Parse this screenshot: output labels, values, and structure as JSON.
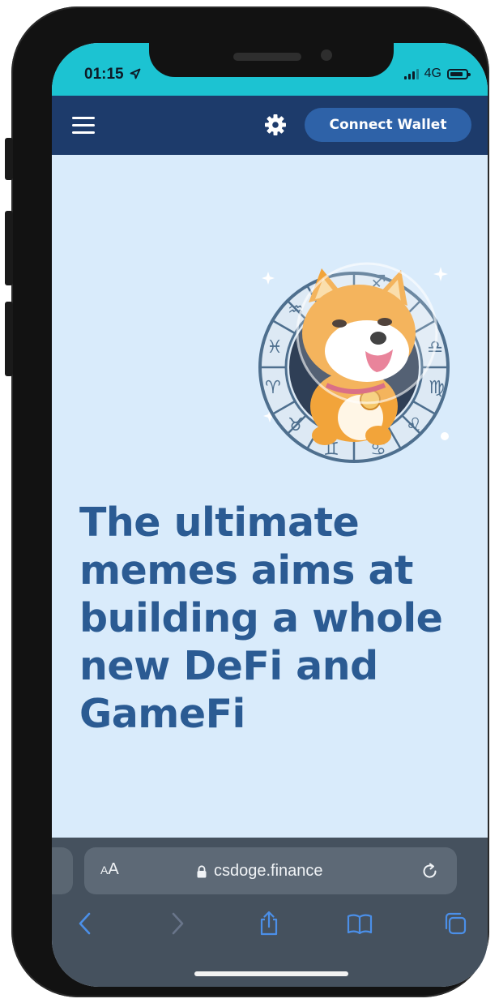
{
  "status_bar": {
    "time": "01:15",
    "network": "4G",
    "location_icon": "location-arrow-icon"
  },
  "site_nav": {
    "menu_icon": "hamburger-menu-icon",
    "settings_icon": "gear-icon",
    "connect_label": "Connect Wallet"
  },
  "hero": {
    "mascot": "shiba-inu-astronaut-zodiac-logo",
    "headline": "The ultimate memes aims at building a whole new DeFi and GameFi"
  },
  "browser": {
    "text_size_label_small": "A",
    "text_size_label_big": "A",
    "url": "csdoge.finance",
    "lock_icon": "lock-icon",
    "reload_icon": "reload-icon",
    "toolbar": [
      "back-icon",
      "forward-icon",
      "share-icon",
      "bookmarks-icon",
      "tabs-icon"
    ]
  },
  "colors": {
    "status_bar_bg": "#1cc3d2",
    "navbar_bg": "#1d3b6b",
    "button_bg": "#2e62a8",
    "page_bg": "#d9ebfb",
    "headline": "#2b5b93",
    "browser_bg": "#45515e"
  }
}
